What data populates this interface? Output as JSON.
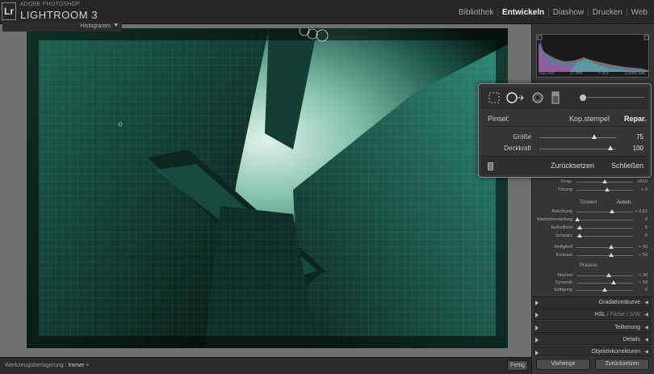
{
  "app": {
    "brand_sub": "ADOBE PHOTOSHOP",
    "brand_main": "LIGHTROOM 3",
    "logo": "Lr"
  },
  "modules": [
    {
      "label": "Bibliothek",
      "active": false
    },
    {
      "label": "Entwickeln",
      "active": true
    },
    {
      "label": "Diashow",
      "active": false
    },
    {
      "label": "Drucken",
      "active": false
    },
    {
      "label": "Web",
      "active": false
    }
  ],
  "toolbar": {
    "overlay_label": "Werkzeugüberlagerung :",
    "overlay_value": "Immer ÷",
    "done_label": "Fertig"
  },
  "histogram": {
    "title": "Histogramm",
    "iso": "ISO 200",
    "focal": "17 mm",
    "aperture": "f / 8,0",
    "shutter": "1/1000 Sek."
  },
  "popup": {
    "brush_label": "Pinsel:",
    "mode_clone": "Kop.stempel",
    "mode_heal": "Repar.",
    "size_label": "Größe",
    "size_value": "75",
    "size_fraction": 0.72,
    "opacity_label": "Deckkraft",
    "opacity_value": "100",
    "opacity_fraction": 0.93,
    "reset_label": "Zurücksetzen",
    "close_label": "Schließen"
  },
  "basic": {
    "temp_label": "Temp.",
    "temp_value": "5550",
    "tint_label": "Tönung",
    "tint_value": "+ 9",
    "tone_label": "Tonwert",
    "auto_label": "Autom.",
    "exposure_label": "Belichtung",
    "exposure_value": "+ 0,61",
    "recovery_label": "Wiederherstellung",
    "recovery_value": "0",
    "fill_label": "Aufhelllicht",
    "fill_value": "5",
    "blacks_label": "Schwarz",
    "blacks_value": "5",
    "brightness_label": "Helligkeit",
    "brightness_value": "+ 50",
    "contrast_label": "Kontrast",
    "contrast_value": "+ 50",
    "presence_label": "Präsenz",
    "clarity_label": "Klarheit",
    "clarity_value": "+ 30",
    "vibrance_label": "Dynamik",
    "vibrance_value": "+ 50",
    "saturation_label": "Sättigung",
    "saturation_value": "0"
  },
  "sections": {
    "tone_curve": "Gradationskurve",
    "hsl": "HSL",
    "color": "Farbe",
    "bw": "S/W",
    "split": "Teiltonung",
    "detail": "Details",
    "lens": "Objektivkorrekturen"
  },
  "footer": {
    "previous": "Vorherige",
    "reset": "Zurücksetzen"
  },
  "colors": {
    "photo_teal": "#2f8a78",
    "photo_dark": "#07130f",
    "highlight": "#ffffff"
  }
}
